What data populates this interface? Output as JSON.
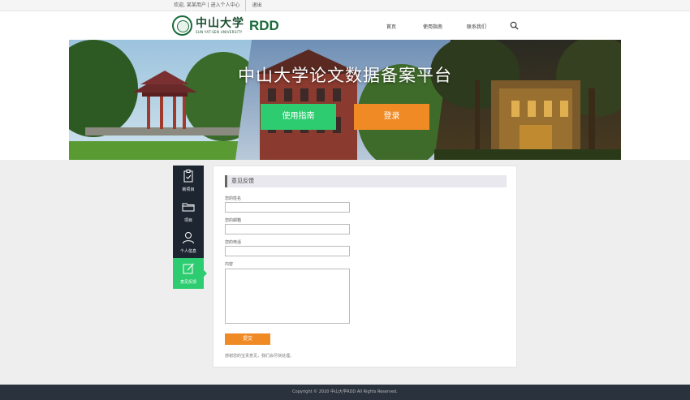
{
  "topbar": {
    "welcome": "欢迎, 某某用户 | 进入个人中心",
    "logout": "退出"
  },
  "header": {
    "logo_cn": "中山大学",
    "logo_en": "SUN YAT-SEN UNIVERSITY",
    "logo_rdd": "RDD",
    "nav": [
      "首页",
      "使用指南",
      "联系我们"
    ]
  },
  "banner": {
    "title": "中山大学论文数据备案平台",
    "guide_label": "使用指南",
    "login_label": "登录"
  },
  "sidenav": {
    "items": [
      {
        "label": "新项目",
        "icon": "clipboard-icon"
      },
      {
        "label": "项目",
        "icon": "folder-icon"
      },
      {
        "label": "个人信息",
        "icon": "user-icon"
      },
      {
        "label": "意见反馈",
        "icon": "edit-icon"
      }
    ]
  },
  "form": {
    "title": "意见反馈",
    "fields": [
      {
        "label": "您的姓名",
        "value": ""
      },
      {
        "label": "您的邮箱",
        "value": ""
      },
      {
        "label": "您的电话",
        "value": ""
      }
    ],
    "content_label": "内容",
    "submit_label": "提交",
    "hint": "感谢您的宝贵意见，我们会尽快处理。"
  },
  "footer": {
    "text": "Copyright © 2020 中山大学RDD All Rights Reserved."
  },
  "colors": {
    "accent_green": "#2ecc71",
    "accent_orange": "#f08a24",
    "dark_nav": "#1c2530",
    "brand_green": "#1a6b3a"
  }
}
